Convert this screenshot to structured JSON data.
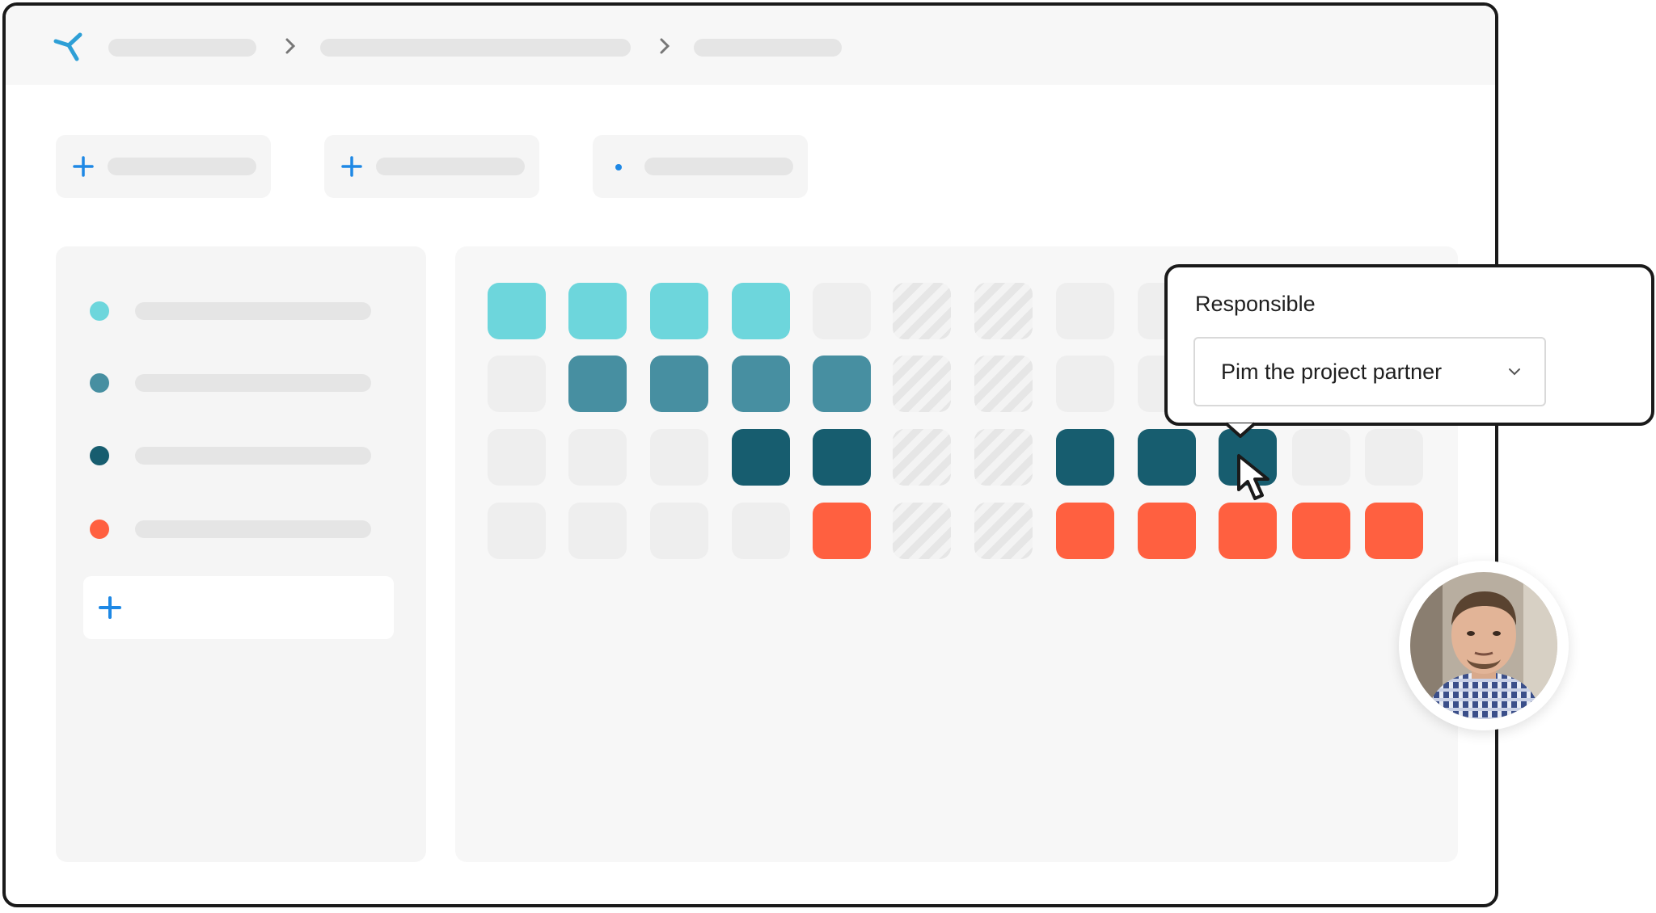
{
  "app": {
    "logo_icon": "brand-logo-icon",
    "accent_color": "#1e88e5"
  },
  "breadcrumb": {
    "separator_icon": "chevron-right-icon"
  },
  "toolbar": {
    "actions": [
      {
        "icon": "plus-icon"
      },
      {
        "icon": "plus-icon"
      },
      {
        "icon": "dot-icon"
      }
    ]
  },
  "legend": {
    "items": [
      {
        "color": "#6dd6dc"
      },
      {
        "color": "#478fa1"
      },
      {
        "color": "#175d6f"
      },
      {
        "color": "#ff6040"
      }
    ],
    "add_icon": "plus-icon"
  },
  "grid": {
    "colors": {
      "1": "#6dd6dc",
      "2": "#478fa1",
      "3": "#175d6f",
      "4": "#ff6040"
    },
    "rows": [
      [
        "1",
        "1",
        "1",
        "1",
        "e",
        "h",
        "h",
        "e",
        "e",
        "e",
        "e",
        "e"
      ],
      [
        "e",
        "2",
        "2",
        "2",
        "2",
        "h",
        "h",
        "e",
        "e",
        "e",
        "e",
        "e"
      ],
      [
        "e",
        "e",
        "e",
        "3",
        "3",
        "h",
        "h",
        "3",
        "3",
        "3",
        "e",
        "e"
      ],
      [
        "e",
        "e",
        "e",
        "e",
        "4",
        "h",
        "h",
        "4",
        "4",
        "4",
        "4",
        "4"
      ]
    ]
  },
  "popup": {
    "label": "Responsible",
    "select_value": "Pim the project partner",
    "chevron_icon": "chevron-down-icon"
  },
  "cursor_icon": "pointer-cursor-icon",
  "avatar_icon": "user-avatar"
}
